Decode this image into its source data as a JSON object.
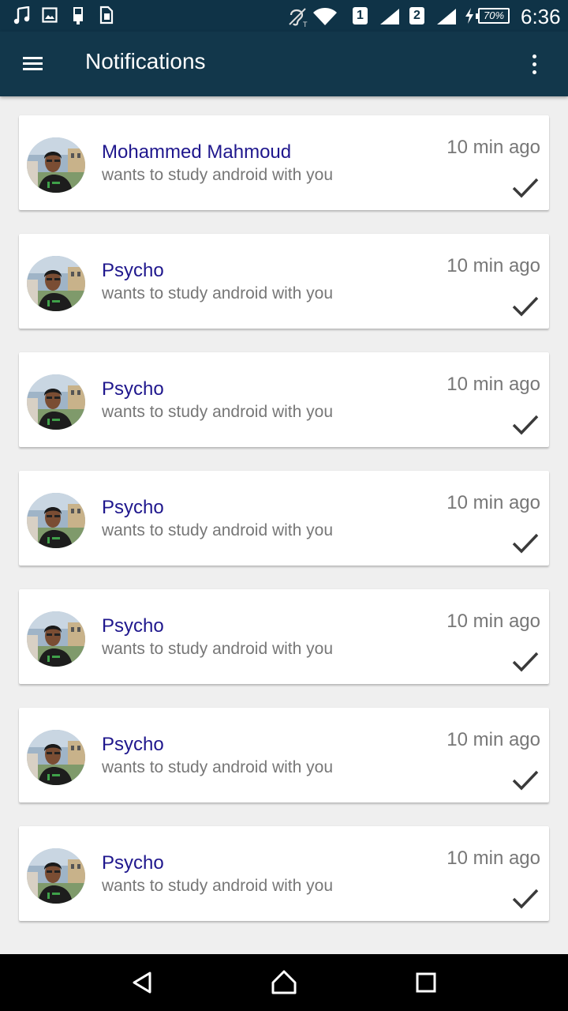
{
  "status_bar": {
    "icons": [
      "music-note-icon",
      "image-icon",
      "usb-icon",
      "sim-card-icon",
      "hearing-aid-icon",
      "wifi-icon",
      "signal-icon",
      "signal-icon",
      "charging-icon"
    ],
    "sim1": "1",
    "sim2": "2",
    "battery": "70%",
    "time": "6:36"
  },
  "app_bar": {
    "title": "Notifications",
    "background": "#12374b",
    "menu_icon": "hamburger-menu-icon",
    "overflow_icon": "more-vert-icon"
  },
  "notifications": [
    {
      "name": "Mohammed Mahmoud",
      "message": "wants to study android with you",
      "time": "10 min ago"
    },
    {
      "name": "Psycho",
      "message": "wants to study android with you",
      "time": "10 min ago"
    },
    {
      "name": "Psycho",
      "message": "wants to study android with you",
      "time": "10 min ago"
    },
    {
      "name": "Psycho",
      "message": "wants to study android with you",
      "time": "10 min ago"
    },
    {
      "name": "Psycho",
      "message": "wants to study android with you",
      "time": "10 min ago"
    },
    {
      "name": "Psycho",
      "message": "wants to study android with you",
      "time": "10 min ago"
    },
    {
      "name": "Psycho",
      "message": "wants to study android with you",
      "time": "10 min ago"
    }
  ],
  "colors": {
    "name": "#1f178d",
    "secondary_text": "#777777",
    "list_background": "#efefef"
  },
  "nav_bar": {
    "icons": [
      "back-icon",
      "home-icon",
      "recents-icon"
    ]
  }
}
